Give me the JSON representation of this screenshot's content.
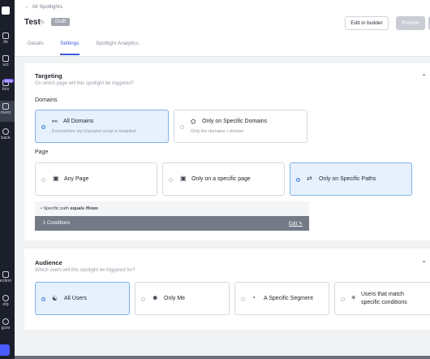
{
  "sidebar": {
    "items": [
      {
        "label": "ile",
        "icon": "profile-icon"
      },
      {
        "label": "uct",
        "icon": "product-icon"
      },
      {
        "label": "tics",
        "icon": "analytics-icon",
        "badge": "Beta"
      },
      {
        "label": "ment",
        "icon": "engagement-icon",
        "active": true
      },
      {
        "label": "back",
        "icon": "feedback-icon"
      },
      {
        "label": "ection",
        "icon": "collection-icon"
      },
      {
        "label": "elp",
        "icon": "help-icon"
      },
      {
        "label": "gure",
        "icon": "configure-icon"
      }
    ]
  },
  "header": {
    "back_label": "All Spotlights",
    "title": "Test",
    "status_badge": "Draft",
    "edit_builder_label": "Edit in builder",
    "publish_label": "Publish",
    "tabs": [
      {
        "label": "Details",
        "active": false
      },
      {
        "label": "Settings",
        "active": true
      },
      {
        "label": "Spotlight Analytics",
        "active": false
      }
    ]
  },
  "targeting": {
    "title": "Targeting",
    "subtitle": "On which page will this spotlight be triggered?",
    "domains_label": "Domains",
    "domains": [
      {
        "label": "All Domains",
        "desc": "Everywhere my Userpilot script is installed",
        "selected": true,
        "icon": "globe-cursor-icon"
      },
      {
        "label": "Only on Specific Domains",
        "desc": "Only the domains I choose",
        "selected": false,
        "icon": "globe-icon"
      }
    ],
    "page_label": "Page",
    "pages": [
      {
        "label": "Any Page",
        "selected": false,
        "icon": "browser-window-icon"
      },
      {
        "label": "Only on a specific page",
        "selected": false,
        "icon": "browser-window-icon"
      },
      {
        "label": "Only on Specific Paths",
        "selected": true,
        "icon": "path-icon"
      }
    ],
    "condition_prefix": "Specific path",
    "condition_rule": "equals /flows",
    "conditions_count": "1 Conditions",
    "edit_label": "Edit"
  },
  "audience": {
    "title": "Audience",
    "subtitle": "Which users will this spotlight be triggered for?",
    "options": [
      {
        "label": "All Users",
        "selected": true,
        "icon": "users-icon"
      },
      {
        "label": "Only Me",
        "selected": false,
        "icon": "user-icon"
      },
      {
        "label": "A Specific Segment",
        "selected": false,
        "icon": "segment-icon"
      },
      {
        "label": "Users that match",
        "label2": "specific conditions",
        "selected": false,
        "icon": "diamond-icon"
      }
    ]
  },
  "colors": {
    "accent": "#3b5bdb",
    "selected_bg": "#e7f1fd",
    "sidebar_bg": "#1b1f2a"
  }
}
